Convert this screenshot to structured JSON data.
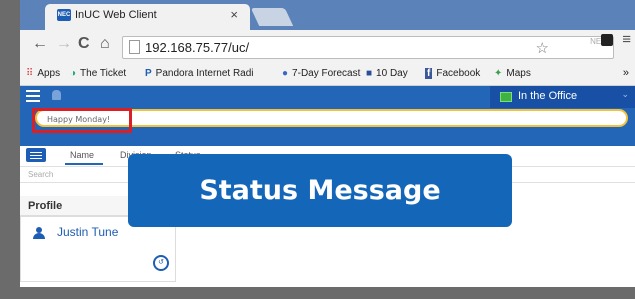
{
  "browser": {
    "tab_title": "InUC Web Client",
    "tab_favicon_text": "NEC",
    "tab_close": "×",
    "url": "192.168.75.77/uc/",
    "bookmarks": [
      {
        "icon": "apps-icon",
        "label": "Apps"
      },
      {
        "icon": "ticket-icon",
        "label": "The Ticket"
      },
      {
        "icon": "pandora-icon",
        "label": "Pandora Internet Radi"
      },
      {
        "icon": "weather-icon",
        "label": "7-Day Forecast"
      },
      {
        "icon": "weather-10day-icon",
        "label": "10 Day"
      },
      {
        "icon": "facebook-icon",
        "label": "Facebook"
      },
      {
        "icon": "maps-icon",
        "label": "Maps"
      }
    ],
    "more": "»"
  },
  "app": {
    "presence_label": "In the Office",
    "status_message_value": "Happy Monday!",
    "tabs": {
      "name": "Name",
      "division": "Division",
      "status": "Status"
    },
    "search_placeholder": "Search",
    "profile_header": "Profile",
    "contact_name": "Justin Tune"
  },
  "callout": {
    "label": "Status Message"
  },
  "colors": {
    "appbar": "#2366b8",
    "accent": "#1e5db4",
    "callout": "#1466b8",
    "highlight_box": "#d82127",
    "input_border": "#f2c13d"
  }
}
